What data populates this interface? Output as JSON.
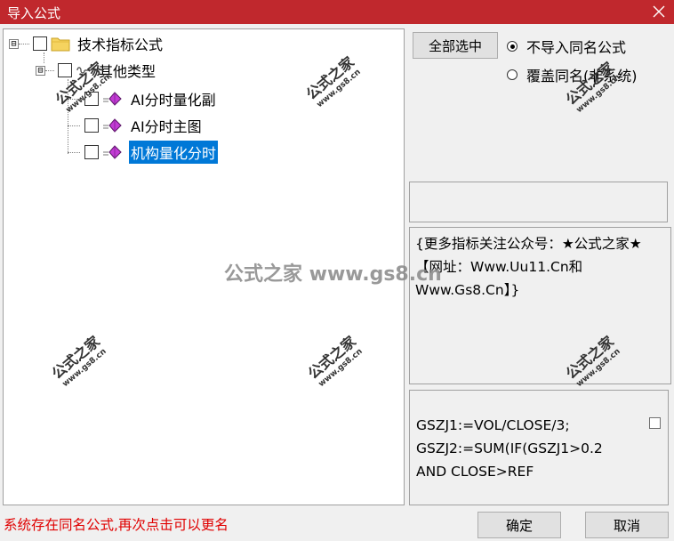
{
  "window": {
    "title": "导入公式"
  },
  "tree": {
    "root": {
      "label": "技术指标公式",
      "expander": "⊟"
    },
    "group": {
      "label": "其他类型",
      "expander": "⊟"
    },
    "items": [
      {
        "label": "AI分时量化副",
        "selected": false
      },
      {
        "label": "AI分时主图",
        "selected": false
      },
      {
        "label": "机构量化分时",
        "selected": true
      }
    ]
  },
  "options": {
    "select_all_label": "全部选中",
    "radio_no_import_label": "不导入同名公式",
    "radio_overwrite_label": "覆盖同名(非系统)",
    "selected_radio": "no_import"
  },
  "description": "{更多指标关注公众号：★公式之家★【网址：Www.Uu11.Cn和Www.Gs8.Cn】}",
  "code_preview": {
    "line1": "GSZJ1:=VOL/CLOSE/3;",
    "line2": "GSZJ2:=SUM(IF(GSZJ1>0.2",
    "line3": "AND CLOSE>REF"
  },
  "status_text": "系统存在同名公式,再次点击可以更名",
  "buttons": {
    "ok_label": "确定",
    "cancel_label": "取消"
  },
  "watermark": {
    "text": "公式之家",
    "url": "www.gs8.cn",
    "center_text": "公式之家 www.gs8.cn"
  },
  "colors": {
    "titlebar": "#c0282d",
    "selection": "#0078d7",
    "status": "#e00000"
  },
  "icons": {
    "folder": "folder-icon",
    "formula": "formula-gem-icon",
    "close": "close-icon"
  }
}
